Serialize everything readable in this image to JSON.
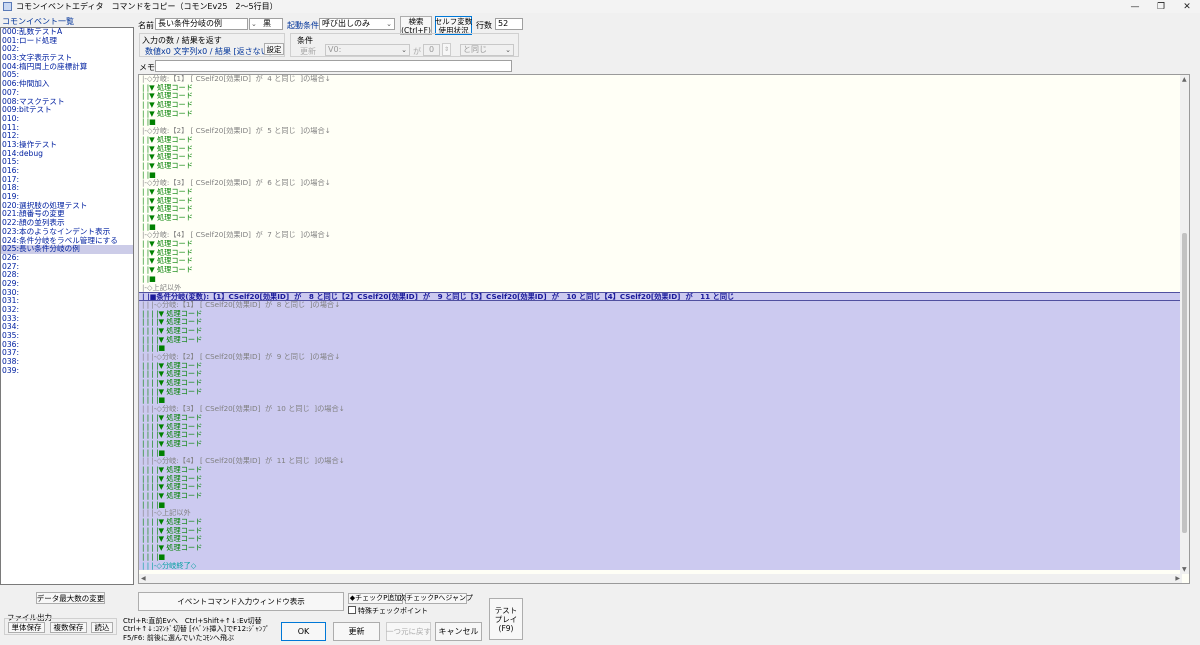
{
  "window": {
    "title": "コモンイベントエディタ　コマンドをコピー（コモンEv25　2～5行目）",
    "minimize": "—",
    "maximize": "❐",
    "close": "✕"
  },
  "left_panel": {
    "title": "コモンイベント一覧",
    "selected_index": 25,
    "items": [
      "000:乱数テストA",
      "001:ロード処理",
      "002:",
      "003:文字表示テスト",
      "004:楕円周上の座標計算",
      "005:",
      "006:仲間加入",
      "007:",
      "008:マスクテスト",
      "009:bitテスト",
      "010:",
      "011:",
      "012:",
      "013:操作テスト",
      "014:debug",
      "015:",
      "016:",
      "017:",
      "018:",
      "019:",
      "020:選択肢の処理テスト",
      "021:顔番号の変更",
      "022:顔の並列表示",
      "023:本のようなインデント表示",
      "024:条件分岐をラベル管理にする",
      "025:長い条件分岐の例",
      "026:",
      "027:",
      "028:",
      "029:",
      "030:",
      "031:",
      "032:",
      "033:",
      "034:",
      "035:",
      "036:",
      "037:",
      "038:",
      "039:"
    ]
  },
  "header": {
    "name_label": "名前",
    "name_value": "長い条件分岐の例",
    "color_value": "黒",
    "trigger_label": "起動条件",
    "trigger_value": "呼び出しのみ",
    "search_button": [
      "検索",
      "(Ctrl+F)"
    ],
    "self_var_button": [
      "セルフ変数",
      "使用状況"
    ],
    "lines_label": "行数",
    "lines_value": "52",
    "io_label": "入力の数 / 結果を返す",
    "io_value": "数値x0 文字列x0 / 結果 [返さない]",
    "io_set_button": "設定",
    "cond_label": "条件",
    "cond_update": "更新",
    "cond_var": "V0:",
    "cond_ga": "が",
    "cond_num": "0",
    "cond_op": "と同じ",
    "memo_label": "メモ",
    "memo_value": ""
  },
  "editor": {
    "lines": [
      {
        "t": "|-◇分岐:【1】 [ CSelf20[効果ID]  が  4 と同じ  ]の場合↓",
        "k": "branch"
      },
      {
        "t": "| |▼ 処理コード",
        "k": "code"
      },
      {
        "t": "| |▼ 処理コード",
        "k": "code"
      },
      {
        "t": "| |▼ 処理コード",
        "k": "code"
      },
      {
        "t": "| |▼ 処理コード",
        "k": "code"
      },
      {
        "t": "| |■",
        "k": "bar"
      },
      {
        "t": "|-◇分岐:【2】 [ CSelf20[効果ID]  が  5 と同じ  ]の場合↓",
        "k": "branch"
      },
      {
        "t": "| |▼ 処理コード",
        "k": "code"
      },
      {
        "t": "| |▼ 処理コード",
        "k": "code"
      },
      {
        "t": "| |▼ 処理コード",
        "k": "code"
      },
      {
        "t": "| |▼ 処理コード",
        "k": "code"
      },
      {
        "t": "| |■",
        "k": "bar"
      },
      {
        "t": "|-◇分岐:【3】 [ CSelf20[効果ID]  が  6 と同じ  ]の場合↓",
        "k": "branch"
      },
      {
        "t": "| |▼ 処理コード",
        "k": "code"
      },
      {
        "t": "| |▼ 処理コード",
        "k": "code"
      },
      {
        "t": "| |▼ 処理コード",
        "k": "code"
      },
      {
        "t": "| |▼ 処理コード",
        "k": "code"
      },
      {
        "t": "| |■",
        "k": "bar"
      },
      {
        "t": "|-◇分岐:【4】 [ CSelf20[効果ID]  が  7 と同じ  ]の場合↓",
        "k": "branch"
      },
      {
        "t": "| |▼ 処理コード",
        "k": "code"
      },
      {
        "t": "| |▼ 処理コード",
        "k": "code"
      },
      {
        "t": "| |▼ 処理コード",
        "k": "code"
      },
      {
        "t": "| |▼ 処理コード",
        "k": "code"
      },
      {
        "t": "| |■",
        "k": "bar"
      },
      {
        "t": "|-◇上記以外",
        "k": "else"
      },
      {
        "t": "| |■条件分岐(変数):【1】CSelf20[効果ID]  が   8 と同じ【2】CSelf20[効果ID]  が   9 と同じ【3】CSelf20[効果ID]  が   10 と同じ【4】CSelf20[効果ID]  が   11 と同じ",
        "k": "cond",
        "sel": true,
        "cur": true
      },
      {
        "t": "| | |-◇分岐:【1】 [ CSelf20[効果ID]  が  8 と同じ  ]の場合↓",
        "k": "branch",
        "sel": true
      },
      {
        "t": "| | | |▼ 処理コード",
        "k": "code",
        "sel": true
      },
      {
        "t": "| | | |▼ 処理コード",
        "k": "code",
        "sel": true
      },
      {
        "t": "| | | |▼ 処理コード",
        "k": "code",
        "sel": true
      },
      {
        "t": "| | | |▼ 処理コード",
        "k": "code",
        "sel": true
      },
      {
        "t": "| | | |■",
        "k": "bar",
        "sel": true
      },
      {
        "t": "| | |-◇分岐:【2】 [ CSelf20[効果ID]  が  9 と同じ  ]の場合↓",
        "k": "branch",
        "sel": true
      },
      {
        "t": "| | | |▼ 処理コード",
        "k": "code",
        "sel": true
      },
      {
        "t": "| | | |▼ 処理コード",
        "k": "code",
        "sel": true
      },
      {
        "t": "| | | |▼ 処理コード",
        "k": "code",
        "sel": true
      },
      {
        "t": "| | | |▼ 処理コード",
        "k": "code",
        "sel": true
      },
      {
        "t": "| | | |■",
        "k": "bar",
        "sel": true
      },
      {
        "t": "| | |-◇分岐:【3】 [ CSelf20[効果ID]  が  10 と同じ  ]の場合↓",
        "k": "branch",
        "sel": true
      },
      {
        "t": "| | | |▼ 処理コード",
        "k": "code",
        "sel": true
      },
      {
        "t": "| | | |▼ 処理コード",
        "k": "code",
        "sel": true
      },
      {
        "t": "| | | |▼ 処理コード",
        "k": "code",
        "sel": true
      },
      {
        "t": "| | | |▼ 処理コード",
        "k": "code",
        "sel": true
      },
      {
        "t": "| | | |■",
        "k": "bar",
        "sel": true
      },
      {
        "t": "| | |-◇分岐:【4】 [ CSelf20[効果ID]  が  11 と同じ  ]の場合↓",
        "k": "branch",
        "sel": true
      },
      {
        "t": "| | | |▼ 処理コード",
        "k": "code",
        "sel": true
      },
      {
        "t": "| | | |▼ 処理コード",
        "k": "code",
        "sel": true
      },
      {
        "t": "| | | |▼ 処理コード",
        "k": "code",
        "sel": true
      },
      {
        "t": "| | | |▼ 処理コード",
        "k": "code",
        "sel": true
      },
      {
        "t": "| | | |■",
        "k": "bar",
        "sel": true
      },
      {
        "t": "| | |-◇上記以外",
        "k": "else",
        "sel": true
      },
      {
        "t": "| | | |▼ 処理コード",
        "k": "code",
        "sel": true
      },
      {
        "t": "| | | |▼ 処理コード",
        "k": "code",
        "sel": true
      },
      {
        "t": "| | | |▼ 処理コード",
        "k": "code",
        "sel": true
      },
      {
        "t": "| | | |▼ 処理コード",
        "k": "code",
        "sel": true
      },
      {
        "t": "| | | |■",
        "k": "bar",
        "sel": true
      },
      {
        "t": "| | |-◇分岐終了◇",
        "k": "end",
        "sel": true
      }
    ]
  },
  "bottom": {
    "data_max_button": "データ最大数の変更",
    "file_output_label": "ファイル出力",
    "single_save": "単体保存",
    "multi_save": "複数保存",
    "load": "読込",
    "command_window_button": "イベントコマンド入力ウィンドウ表示",
    "checkpoint_add": "◆チェックP追加",
    "checkpoint_next": "次チェックPへジャンプ",
    "special_check": "特殊チェックポイント",
    "tips": [
      "Ctrl+R:直前Evへ　Ctrl+Shift+↑↓:Ev切替",
      "Ctrl+↑↓:ｺﾏﾝﾄﾞ切替 [ｲﾍﾞﾝﾄ挿入]でF12:ｼﾞｬﾝﾌﾟ",
      "F5/F6: 前後に選んでいたｺﾓﾝへ飛ぶ"
    ],
    "ok": "OK",
    "update": "更新",
    "undo": "一つ元に戻す",
    "cancel": "キャンセル",
    "test_play": [
      "テスト",
      "プレイ",
      "(F9)"
    ]
  }
}
